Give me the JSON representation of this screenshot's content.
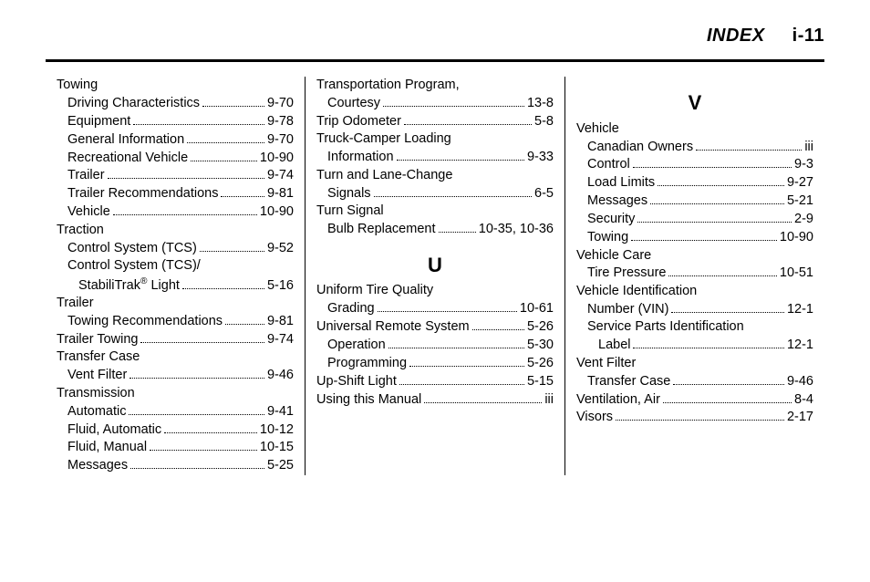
{
  "header": {
    "index_label": "INDEX",
    "page_label": "i-11"
  },
  "col1": [
    {
      "type": "head",
      "label": "Towing"
    },
    {
      "type": "sub",
      "label": "Driving Characteristics",
      "page": "9-70"
    },
    {
      "type": "sub",
      "label": "Equipment",
      "page": "9-78"
    },
    {
      "type": "sub",
      "label": "General Information",
      "page": "9-70"
    },
    {
      "type": "sub",
      "label": "Recreational Vehicle",
      "page": "10-90"
    },
    {
      "type": "sub",
      "label": "Trailer",
      "page": "9-74"
    },
    {
      "type": "sub",
      "label": "Trailer Recommendations",
      "page": "9-81"
    },
    {
      "type": "sub",
      "label": "Vehicle",
      "page": "10-90"
    },
    {
      "type": "head",
      "label": "Traction"
    },
    {
      "type": "sub",
      "label": "Control System (TCS)",
      "page": "9-52"
    },
    {
      "type": "subhead",
      "label": "Control System (TCS)/"
    },
    {
      "type": "subcont",
      "label_html": "StabiliTrak<sup>&reg;</sup> Light",
      "page": "5-16"
    },
    {
      "type": "head",
      "label": "Trailer"
    },
    {
      "type": "sub",
      "label": "Towing Recommendations",
      "page": "9-81"
    },
    {
      "type": "entry",
      "label": "Trailer Towing",
      "page": "9-74"
    },
    {
      "type": "head",
      "label": "Transfer Case"
    },
    {
      "type": "sub",
      "label": "Vent Filter",
      "page": "9-46"
    },
    {
      "type": "head",
      "label": "Transmission"
    },
    {
      "type": "sub",
      "label": "Automatic",
      "page": "9-41"
    },
    {
      "type": "sub",
      "label": "Fluid, Automatic",
      "page": "10-12"
    },
    {
      "type": "sub",
      "label": "Fluid, Manual",
      "page": "10-15"
    },
    {
      "type": "sub",
      "label": "Messages",
      "page": "5-25"
    }
  ],
  "col2": [
    {
      "type": "head",
      "label": "Transportation Program,"
    },
    {
      "type": "sub",
      "label": "Courtesy",
      "page": "13-8"
    },
    {
      "type": "entry",
      "label": "Trip Odometer",
      "page": "5-8"
    },
    {
      "type": "head",
      "label": "Truck-Camper Loading"
    },
    {
      "type": "sub",
      "label": "Information",
      "page": "9-33"
    },
    {
      "type": "head",
      "label": "Turn and Lane-Change"
    },
    {
      "type": "sub",
      "label": "Signals",
      "page": "6-5"
    },
    {
      "type": "head",
      "label": "Turn Signal"
    },
    {
      "type": "sub",
      "label": "Bulb Replacement",
      "page": "10-35, 10-36"
    },
    {
      "type": "letter",
      "label": "U"
    },
    {
      "type": "head",
      "label": "Uniform Tire Quality"
    },
    {
      "type": "sub",
      "label": "Grading",
      "page": "10-61"
    },
    {
      "type": "entry",
      "label": "Universal Remote System",
      "page": "5-26"
    },
    {
      "type": "sub",
      "label": "Operation",
      "page": "5-30"
    },
    {
      "type": "sub",
      "label": "Programming",
      "page": "5-26"
    },
    {
      "type": "entry",
      "label": "Up-Shift Light",
      "page": "5-15"
    },
    {
      "type": "entry",
      "label": "Using this Manual",
      "page": "iii"
    }
  ],
  "col3": [
    {
      "type": "letter",
      "label": "V"
    },
    {
      "type": "head",
      "label": "Vehicle"
    },
    {
      "type": "sub",
      "label": "Canadian Owners",
      "page": "iii"
    },
    {
      "type": "sub",
      "label": "Control",
      "page": "9-3"
    },
    {
      "type": "sub",
      "label": "Load Limits",
      "page": "9-27"
    },
    {
      "type": "sub",
      "label": "Messages",
      "page": "5-21"
    },
    {
      "type": "sub",
      "label": "Security",
      "page": "2-9"
    },
    {
      "type": "sub",
      "label": "Towing",
      "page": "10-90"
    },
    {
      "type": "head",
      "label": "Vehicle Care"
    },
    {
      "type": "sub",
      "label": "Tire Pressure",
      "page": "10-51"
    },
    {
      "type": "head",
      "label": "Vehicle Identification"
    },
    {
      "type": "sub",
      "label": "Number (VIN)",
      "page": "12-1"
    },
    {
      "type": "subhead",
      "label": "Service Parts Identification"
    },
    {
      "type": "subcont",
      "label": "Label",
      "page": "12-1"
    },
    {
      "type": "head",
      "label": "Vent Filter"
    },
    {
      "type": "sub",
      "label": "Transfer Case",
      "page": "9-46"
    },
    {
      "type": "entry",
      "label": "Ventilation, Air",
      "page": "8-4"
    },
    {
      "type": "entry",
      "label": "Visors",
      "page": "2-17"
    }
  ]
}
